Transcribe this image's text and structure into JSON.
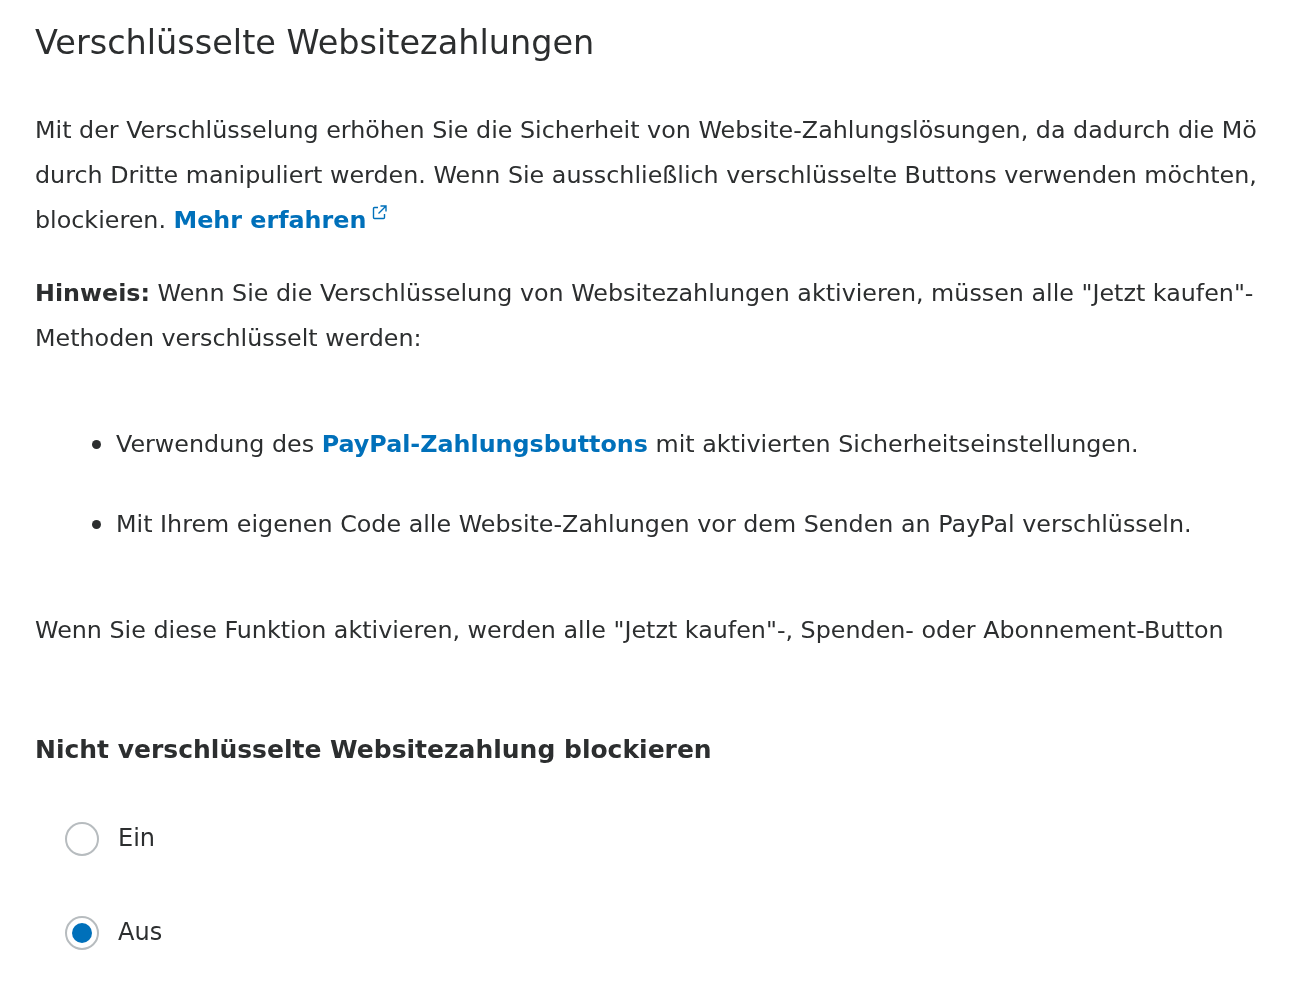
{
  "title": "Verschlüsselte Websitezahlungen",
  "intro": {
    "lines": [
      "Mit der Verschlüsselung erhöhen Sie die Sicherheit von Website-Zahlungslösungen, da dadurch die Mö",
      "durch Dritte manipuliert werden. Wenn Sie ausschließlich verschlüsselte Buttons verwenden möchten,",
      "blockieren."
    ],
    "link": "Mehr erfahren"
  },
  "note": {
    "lines": [
      "**Hinweis:** Wenn Sie die Verschlüsselung von Websitezahlungen aktivieren, müssen alle \"Jetzt kaufen\"-",
      "Methoden verschlüsselt werden:"
    ]
  },
  "methods": [
    {
      "before": "Verwendung des ",
      "link": "PayPal-Zahlungsbuttons",
      "after": " mit aktivierten Sicherheitseinstellungen."
    },
    {
      "before": "Mit Ihrem eigenen Code alle Website-Zahlungen vor dem Senden an PayPal verschlüsseln."
    }
  ],
  "effect": "Wenn Sie diese Funktion aktivieren, werden alle \"Jetzt kaufen\"-, Spenden- oder Abonnement-Button",
  "setting": {
    "heading": "Nicht verschlüsselte Websitezahlung blockieren",
    "options": [
      {
        "label": "Ein",
        "selected": false
      },
      {
        "label": "Aus",
        "selected": true
      }
    ]
  }
}
